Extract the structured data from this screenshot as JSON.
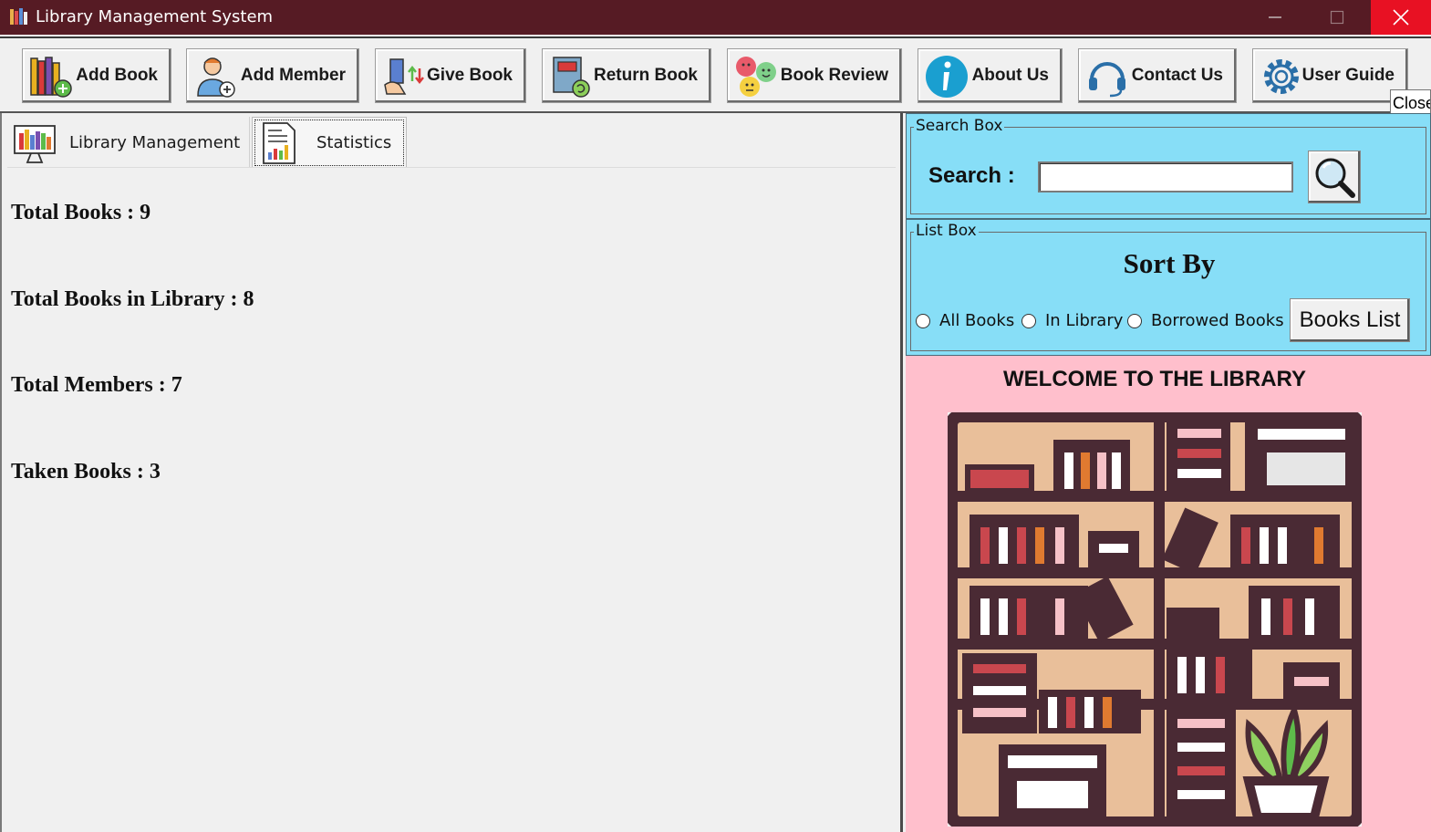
{
  "window": {
    "title": "Library Management System",
    "tooltip": "Close"
  },
  "toolbar": {
    "buttons": [
      {
        "label": "Add Book",
        "icon": "books-add-icon"
      },
      {
        "label": "Add Member",
        "icon": "member-add-icon"
      },
      {
        "label": "Give Book",
        "icon": "give-book-icon"
      },
      {
        "label": "Return Book",
        "icon": "return-book-icon"
      },
      {
        "label": "Book Review",
        "icon": "review-faces-icon"
      },
      {
        "label": "About Us",
        "icon": "info-icon"
      },
      {
        "label": "Contact Us",
        "icon": "headset-icon"
      },
      {
        "label": "User Guide",
        "icon": "gear-icon"
      }
    ]
  },
  "tabs": [
    {
      "label": "Library Management",
      "icon": "library-monitor-icon"
    },
    {
      "label": "Statistics",
      "icon": "statistics-report-icon",
      "selected": true
    }
  ],
  "statistics": {
    "total_books": "Total Books : 9",
    "total_in_library": "Total Books in Library : 8",
    "total_members": "Total Members : 7",
    "taken_books": "Taken Books : 3"
  },
  "search_box": {
    "group_label": "Search Box",
    "label": "Search :",
    "value": ""
  },
  "list_box": {
    "group_label": "List Box",
    "heading": "Sort By",
    "options": [
      "All Books",
      "In Library",
      "Borrowed Books"
    ],
    "button_label": "Books List"
  },
  "welcome": {
    "title": "WELCOME TO THE LIBRARY"
  },
  "colors": {
    "titlebar": "#561b24",
    "panel_blue": "#87def7",
    "welcome_pink": "#ffbfcc",
    "close_red": "#e81123"
  }
}
